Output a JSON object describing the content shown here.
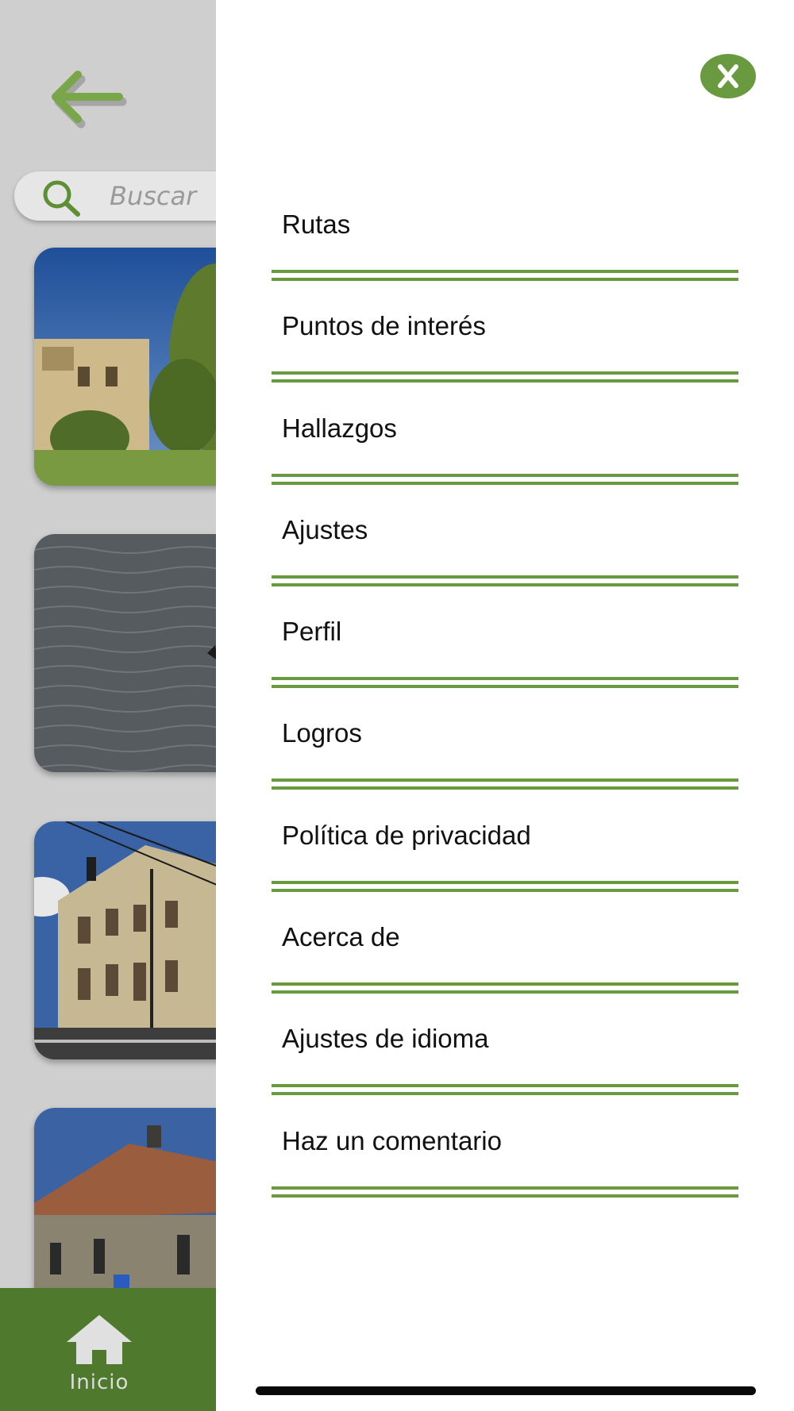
{
  "search": {
    "placeholder": "Buscar"
  },
  "tab_bar": {
    "home_label": "Inicio"
  },
  "menu": {
    "items": [
      {
        "label": "Rutas"
      },
      {
        "label": "Puntos de interés"
      },
      {
        "label": "Hallazgos"
      },
      {
        "label": "Ajustes"
      },
      {
        "label": "Perfil"
      },
      {
        "label": "Logros"
      },
      {
        "label": "Política de privacidad"
      },
      {
        "label": "Acerca de"
      },
      {
        "label": "Ajustes de idioma"
      },
      {
        "label": "Haz un comentario"
      }
    ]
  },
  "icons": {
    "back": "arrow-left-icon",
    "search": "search-icon",
    "home": "home-icon",
    "close": "close-icon"
  },
  "colors": {
    "accent": "#6a9a3f",
    "tab_bar": "#4f7a2d",
    "dimmed_background": "#cfcfcf"
  }
}
